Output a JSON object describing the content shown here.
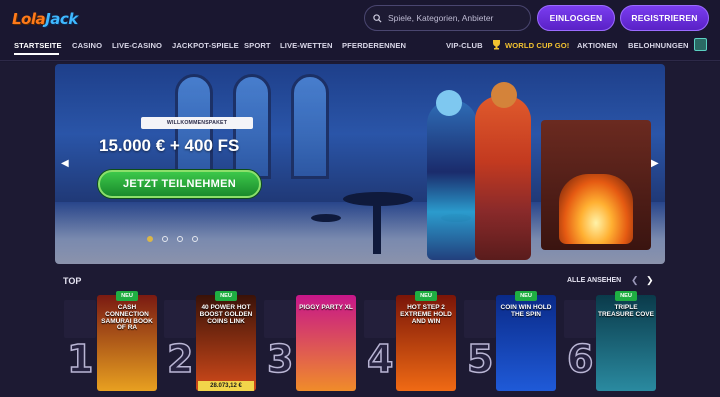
{
  "header": {
    "logo": {
      "part1": "Lola",
      "part2": "Jack"
    },
    "search": {
      "placeholder": "Spiele, Kategorien, Anbieter"
    },
    "login_label": "EINLOGGEN",
    "register_label": "REGISTRIEREN"
  },
  "nav": {
    "items": [
      {
        "label": "STARTSEITE",
        "active": true
      },
      {
        "label": "CASINO"
      },
      {
        "label": "LIVE-CASINO"
      },
      {
        "label": "JACKPOT-SPIELE"
      },
      {
        "label": "SPORT"
      },
      {
        "label": "LIVE-WETTEN"
      },
      {
        "label": "PFERDERENNEN"
      },
      {
        "label": "VIP-CLUB"
      },
      {
        "label": "WORLD CUP GO!",
        "icon": "trophy-icon"
      },
      {
        "label": "AKTIONEN"
      },
      {
        "label": "BELOHNUNGEN"
      }
    ],
    "extra_icon": "gift-icon"
  },
  "banner": {
    "tag": "WILLKOMMENSPAKET",
    "headline": "15.000 € + 400 FS",
    "cta_label": "JETZT TEILNEHMEN",
    "slides": 4,
    "active_slide": 1
  },
  "top": {
    "title": "TOP",
    "see_all_label": "ALLE ANSEHEN",
    "new_badge": "NEU",
    "games": [
      {
        "rank": "1",
        "title": "CASH CONNECTION SAMURAI BOOK OF RA",
        "new": true,
        "colors": [
          "#7a1a12",
          "#e8a020"
        ]
      },
      {
        "rank": "2",
        "title": "40 POWER HOT BOOST GOLDEN COINS LINK",
        "new": true,
        "jackpot": "28.073,12 €",
        "colors": [
          "#3a1208",
          "#d24a1a"
        ]
      },
      {
        "rank": "3",
        "title": "PIGGY PARTY XL",
        "new": false,
        "colors": [
          "#c7168a",
          "#f08c2a"
        ]
      },
      {
        "rank": "4",
        "title": "HOT STEP 2 EXTREME HOLD AND WIN",
        "new": true,
        "colors": [
          "#7a1508",
          "#f06a14"
        ]
      },
      {
        "rank": "5",
        "title": "COIN WIN HOLD THE SPIN",
        "new": true,
        "colors": [
          "#0a2a88",
          "#1f5ad8"
        ]
      },
      {
        "rank": "6",
        "title": "TRIPLE TREASURE COVE",
        "new": true,
        "colors": [
          "#0a3a4a",
          "#2a8aa0"
        ]
      }
    ]
  },
  "colors": {
    "background": "#1d1a33",
    "accent": "#6a2de0",
    "cta_green": "#2aa83a",
    "new_badge": "#1fae42"
  }
}
